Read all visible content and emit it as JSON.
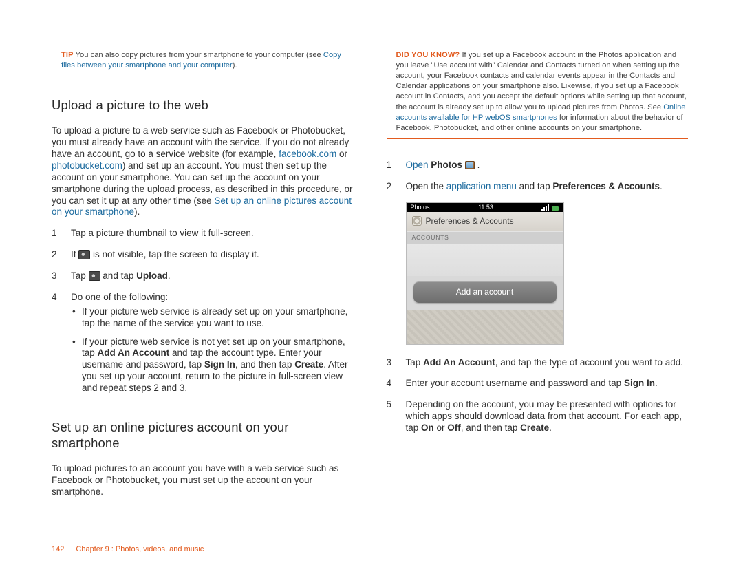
{
  "colors": {
    "accent": "#e25b1f",
    "link": "#1b6a9e",
    "text": "#303030"
  },
  "left": {
    "callout": {
      "lead": "TIP",
      "body1": "You can also copy pictures from your smartphone to your computer (see ",
      "link": "Copy files between your smartphone and your computer",
      "body2": ")."
    },
    "h1": "Upload a picture to the web",
    "p1_a": "To upload a picture to a web service such as Facebook or Photobucket, you must already have an account with the service. If you do not already have an account, go to a service website (for example, ",
    "p1_link1": "facebook.com",
    "p1_b": " or ",
    "p1_link2": "photobucket.com",
    "p1_c": ") and set up an account. You must then set up the account on your smartphone. You can set up the account on your smartphone during the upload process, as described in this procedure, or you can set it up at any other time (see ",
    "p1_link3": "Set up an online pictures account on your smartphone",
    "p1_d": ").",
    "s1": "Tap a picture thumbnail to view it full-screen.",
    "s2_a": "If ",
    "s2_b": " is not visible, tap the screen to display it.",
    "s3_a": "Tap ",
    "s3_b": " and tap ",
    "s3_bold": "Upload",
    "s3_c": ".",
    "s4": "Do one of the following:",
    "s4_sub1": "If your picture web service is already set up on your smartphone, tap the name of the service you want to use.",
    "s4_sub2_a": "If your picture web service is not yet set up on your smartphone, tap ",
    "s4_sub2_b1": "Add An Account",
    "s4_sub2_c": " and tap the account type. Enter your username and password, tap ",
    "s4_sub2_b2": "Sign In",
    "s4_sub2_d": ", and then tap ",
    "s4_sub2_b3": "Create",
    "s4_sub2_e": ". After you set up your account, return to the picture in full-screen view and repeat steps 2 and 3.",
    "h2": "Set up an online pictures account on your smartphone",
    "p2": "To upload pictures to an account you have with a web service such as Facebook or Photobucket, you must set up the account on your smartphone."
  },
  "right": {
    "callout": {
      "lead": "DID YOU KNOW?",
      "body1": "If you set up a Facebook account in the Photos application and you leave \"Use account with\" Calendar and Contacts turned on when setting up the account, your Facebook contacts and calendar events appear in the Contacts and Calendar applications on your smartphone also. Likewise, if you set up a Facebook account in Contacts, and you accept the default options while setting up that account, the account is already set up to allow you to upload pictures from Photos. See ",
      "link": "Online accounts available for HP webOS smartphones",
      "body2": " for information about the behavior of Facebook, Photobucket, and other online accounts on your smartphone."
    },
    "s1_link": "Open",
    "s1_bold": "Photos",
    "s1_tail": " .",
    "s2_a": "Open the ",
    "s2_link": "application menu",
    "s2_b": " and tap ",
    "s2_bold": "Preferences & Accounts",
    "s2_c": ".",
    "screenshot": {
      "status_app": "Photos",
      "status_time": "11:53",
      "title": "Preferences & Accounts",
      "section_label": "ACCOUNTS",
      "button": "Add an account"
    },
    "s3_a": "Tap ",
    "s3_bold": "Add An Account",
    "s3_b": ", and tap the type of account you want to add.",
    "s4_a": "Enter your account username and password and tap ",
    "s4_bold": "Sign In",
    "s4_b": ".",
    "s5_a": "Depending on the account, you may be presented with options for which apps should download data from that account. For each app, tap ",
    "s5_b1": "On",
    "s5_mid": " or ",
    "s5_b2": "Off",
    "s5_c": ", and then tap ",
    "s5_b3": "Create",
    "s5_d": "."
  },
  "footer": {
    "page": "142",
    "chapter": "Chapter 9 : Photos, videos, and music"
  }
}
